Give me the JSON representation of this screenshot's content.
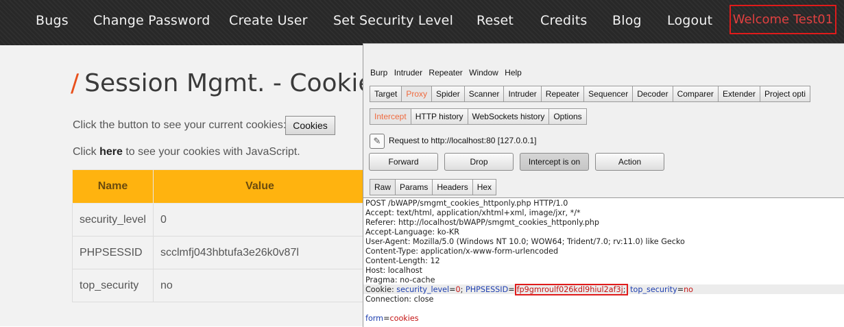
{
  "nav": {
    "items": [
      "Bugs",
      "Change Password",
      "Create User",
      "Set Security Level",
      "Reset",
      "Credits",
      "Blog",
      "Logout"
    ],
    "welcome": "Welcome Test01"
  },
  "page": {
    "title_slash": "/",
    "title": "Session Mgmt. - Cookies",
    "line1": "Click the button to see your current cookies:",
    "cookies_button": "Cookies",
    "line2_pre": "Click ",
    "line2_link": "here",
    "line2_post": " to see your cookies with JavaScript.",
    "table": {
      "headers": [
        "Name",
        "Value"
      ],
      "rows": [
        [
          "security_level",
          "0"
        ],
        [
          "PHPSESSID",
          "scclmfj043hbtufa3e26k0v87l"
        ],
        [
          "top_security",
          "no"
        ]
      ]
    }
  },
  "burp": {
    "menu": [
      "Burp",
      "Intruder",
      "Repeater",
      "Window",
      "Help"
    ],
    "main_tabs": [
      "Target",
      "Proxy",
      "Spider",
      "Scanner",
      "Intruder",
      "Repeater",
      "Sequencer",
      "Decoder",
      "Comparer",
      "Extender",
      "Project opti"
    ],
    "main_active": "Proxy",
    "sub_tabs": [
      "Intercept",
      "HTTP history",
      "WebSockets history",
      "Options"
    ],
    "sub_active": "Intercept",
    "request_info": "Request to http://localhost:80  [127.0.0.1]",
    "buttons": {
      "forward": "Forward",
      "drop": "Drop",
      "intercept": "Intercept is on",
      "action": "Action"
    },
    "view_tabs": [
      "Raw",
      "Params",
      "Headers",
      "Hex"
    ],
    "view_active": "Raw",
    "raw_lines": [
      "POST /bWAPP/smgmt_cookies_httponly.php HTTP/1.0",
      "Accept: text/html, application/xhtml+xml, image/jxr, */*",
      "Referer: http://localhost/bWAPP/smgmt_cookies_httponly.php",
      "Accept-Language: ko-KR",
      "User-Agent: Mozilla/5.0 (Windows NT 10.0; WOW64; Trident/7.0; rv:11.0) like Gecko",
      "Content-Type: application/x-www-form-urlencoded",
      "Content-Length: 12",
      "Host: localhost",
      "Pragma: no-cache"
    ],
    "cookie_line": {
      "label": "Cookie: ",
      "k1": "security_level",
      "eq1": "=",
      "v1": "0",
      "sep1": "; ",
      "k2": "PHPSESSID",
      "eq2": "=",
      "v2": "fp9gmroulf026kdl9hiul2af3j",
      "sep2": ";",
      "k3": " top_security",
      "eq3": "=",
      "v3": "no"
    },
    "after_cookie": "Connection: close",
    "body": {
      "key": "form",
      "eq": "=",
      "value": "cookies"
    }
  },
  "colors": {
    "accent_orange": "#ffb30f",
    "highlight_red": "#e01b1b",
    "burp_orange": "#ef6a3e",
    "param_blue": "#1e3fb0",
    "value_red": "#c41414"
  }
}
